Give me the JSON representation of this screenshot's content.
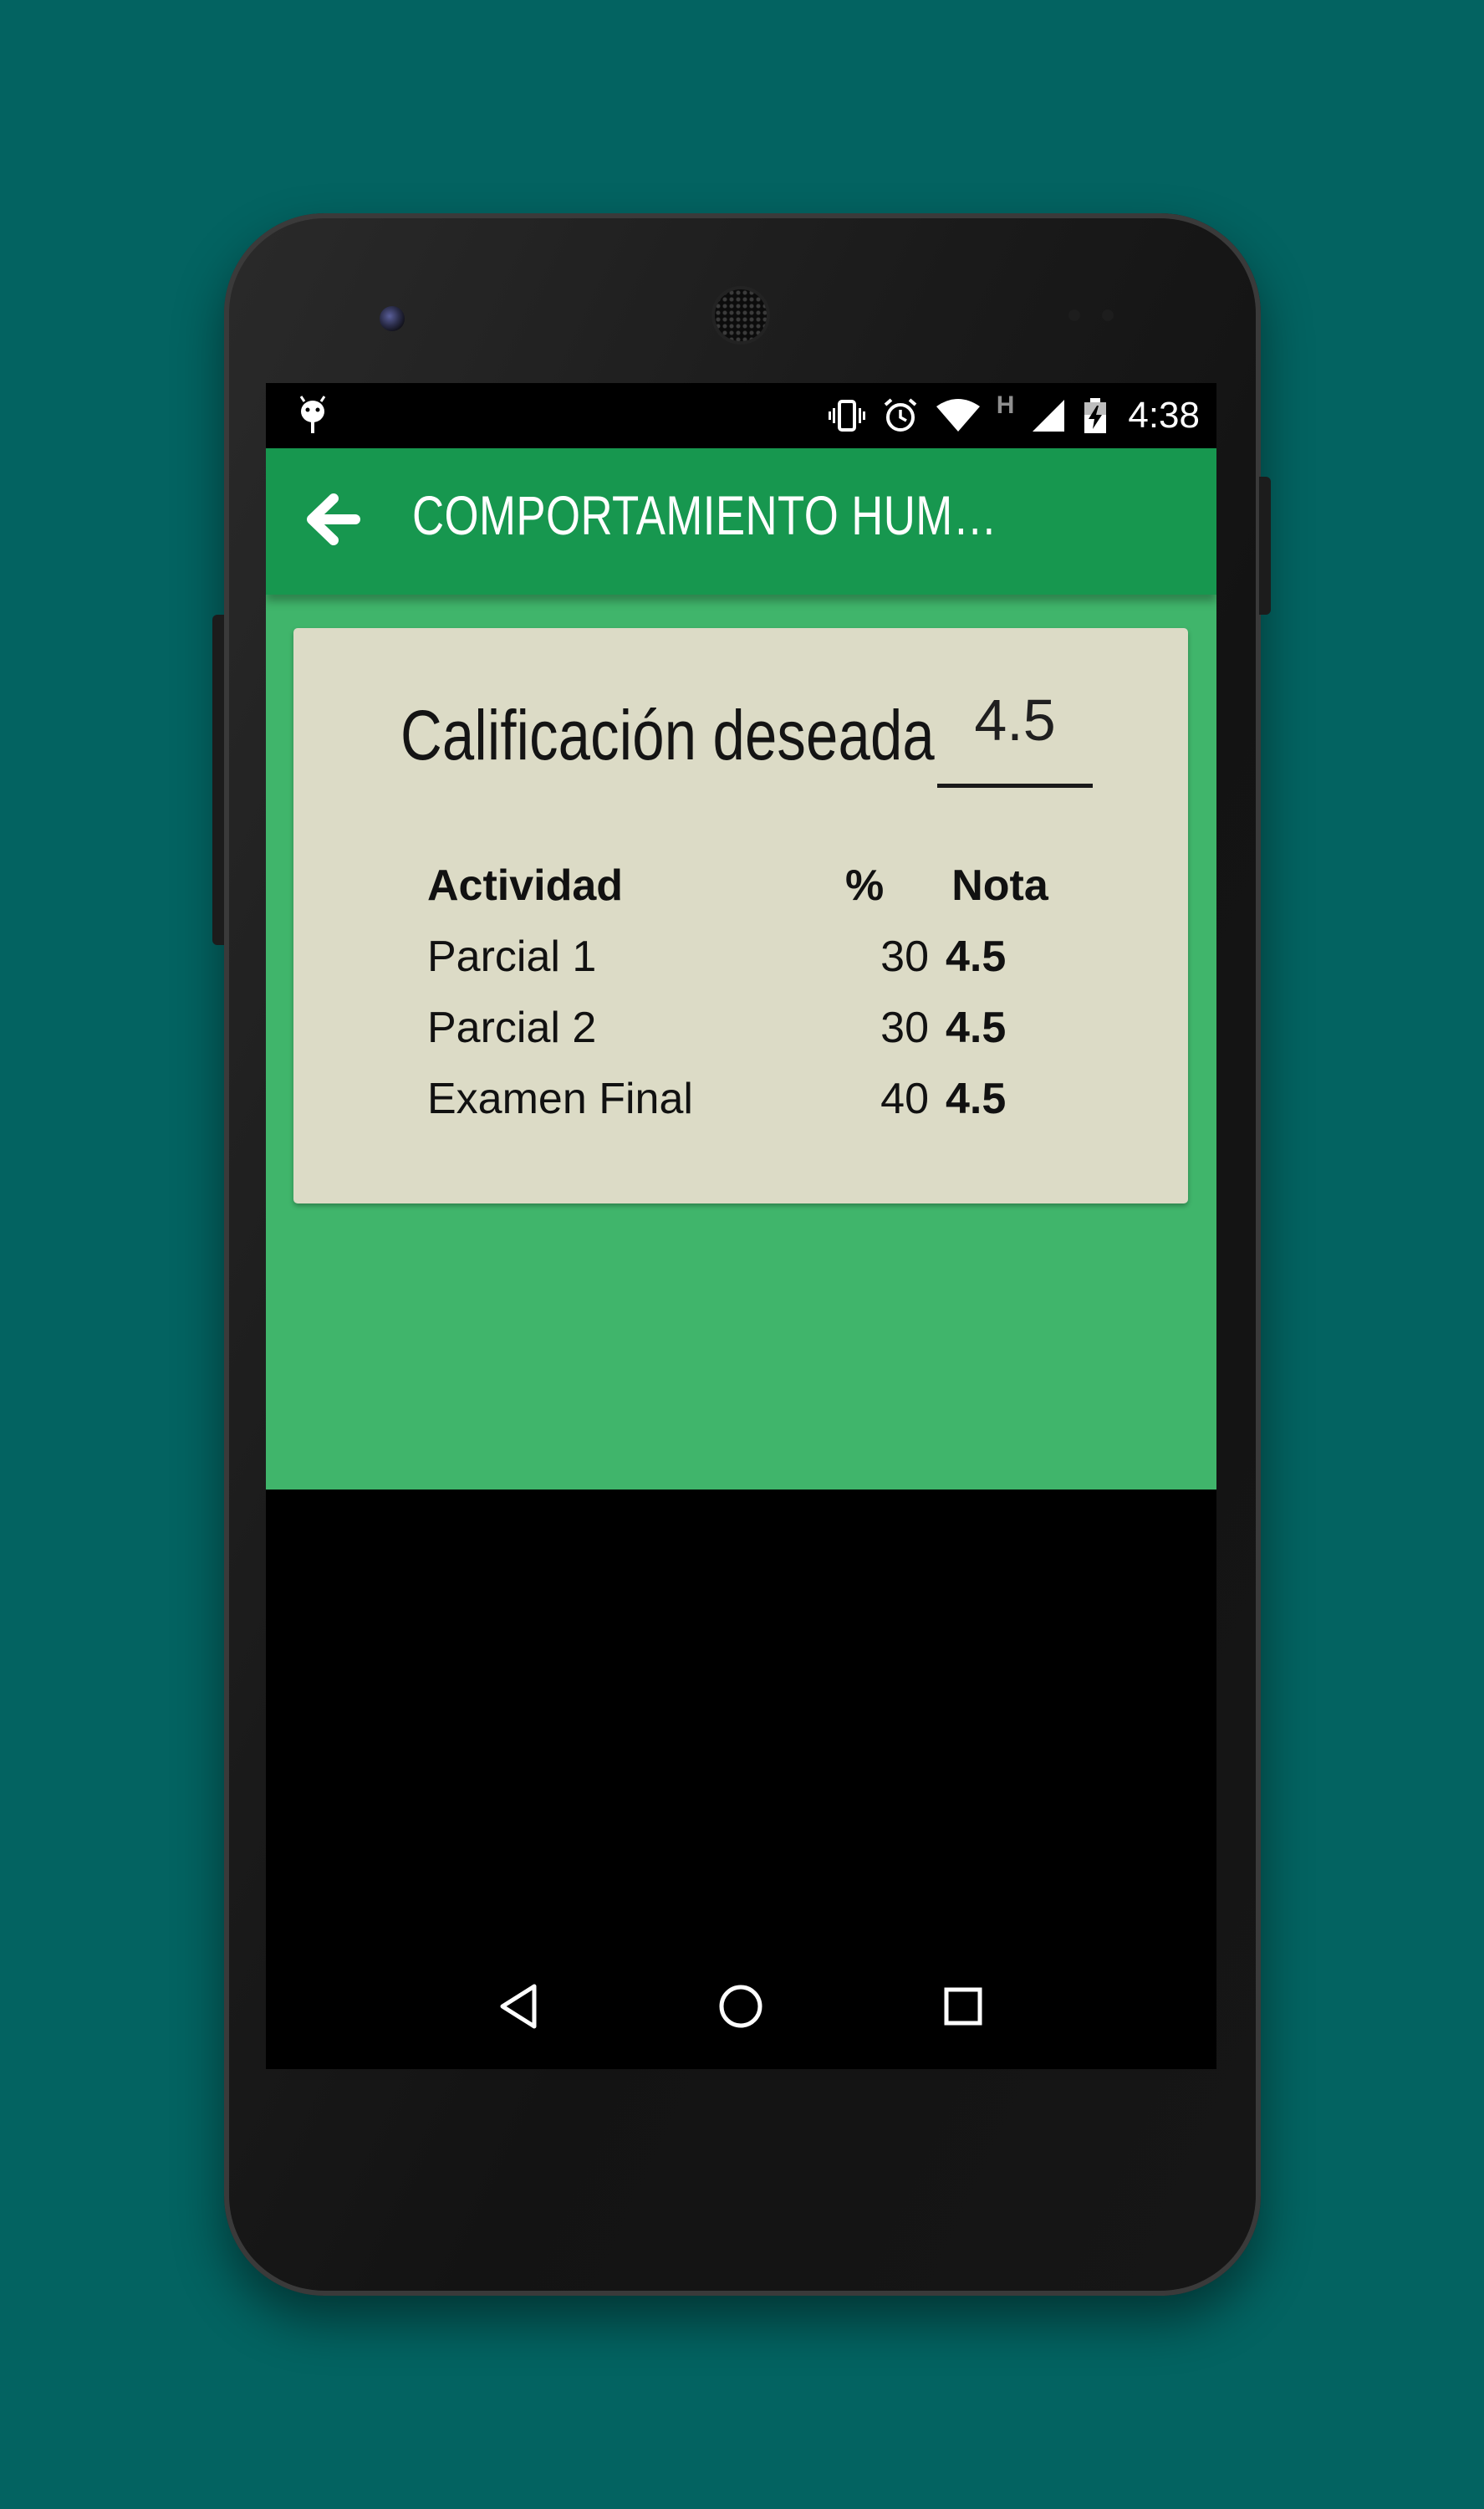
{
  "status_bar": {
    "time": "4:38",
    "network_type": "H",
    "icons": [
      "android-debug-icon",
      "vibrate-icon",
      "alarm-icon",
      "wifi-icon",
      "cell-signal-icon",
      "battery-charging-icon"
    ]
  },
  "app_bar": {
    "title": "COMPORTAMIENTO HUMANO EN …",
    "back_icon": "arrow-left-icon"
  },
  "card": {
    "desired_label": "Calificación deseada",
    "desired_value": "4.5",
    "table": {
      "headers": {
        "activity": "Actividad",
        "percent": "%",
        "grade": "Nota"
      },
      "rows": [
        {
          "activity": "Parcial 1",
          "percent": "30",
          "grade": "4.5"
        },
        {
          "activity": "Parcial 2",
          "percent": "30",
          "grade": "4.5"
        },
        {
          "activity": "Examen Final",
          "percent": "40",
          "grade": "4.5"
        }
      ]
    }
  },
  "nav_bar": {
    "icons": [
      "back-triangle-icon",
      "home-circle-icon",
      "recents-square-icon"
    ]
  },
  "colors": {
    "background": "#036361",
    "app_bar": "#17974f",
    "content": "#40b56b",
    "card": "#dcdbc6",
    "phone_body": "#1a1a1a"
  }
}
